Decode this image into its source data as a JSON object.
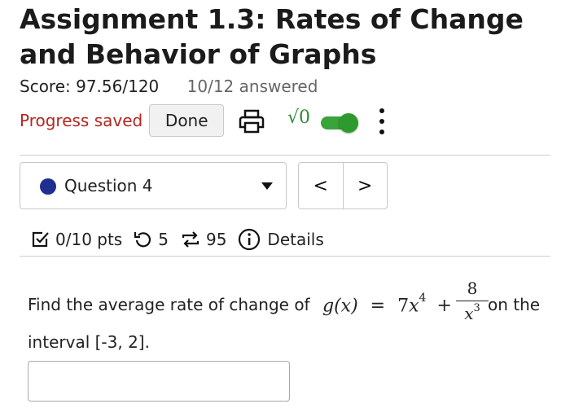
{
  "assignment": {
    "title": "Assignment 1.3: Rates of Change and Behavior of Graphs"
  },
  "status": {
    "score": "Score: 97.56/120",
    "answered": "10/12 answered",
    "progress": "Progress saved",
    "done_label": "Done"
  },
  "toolbar": {
    "print_icon": "printer-icon",
    "math_toggle_label": "√0",
    "math_toggle_on": true,
    "more_icon": "kebab-menu-icon"
  },
  "question_nav": {
    "selected_question": "Question 4",
    "prev_label": "<",
    "next_label": ">"
  },
  "question_meta": {
    "points": "0/10 pts",
    "attempts": "5",
    "submissions": "95",
    "details_label": "Details"
  },
  "question": {
    "prompt_before": "Find the average rate of change of",
    "function_name": "g(x)",
    "equals": "=",
    "term1_coef": "7",
    "term1_var": "x",
    "term1_exp": "4",
    "plus": "+",
    "frac_num": "8",
    "frac_den_var": "x",
    "frac_den_exp": "3",
    "prompt_after": "on the",
    "prompt_line2": "interval [-3, 2].",
    "answer_value": ""
  },
  "colors": {
    "progress_text": "#b3261e",
    "toggle_on": "#3aa339",
    "question_dot": "#1f2f8f"
  }
}
